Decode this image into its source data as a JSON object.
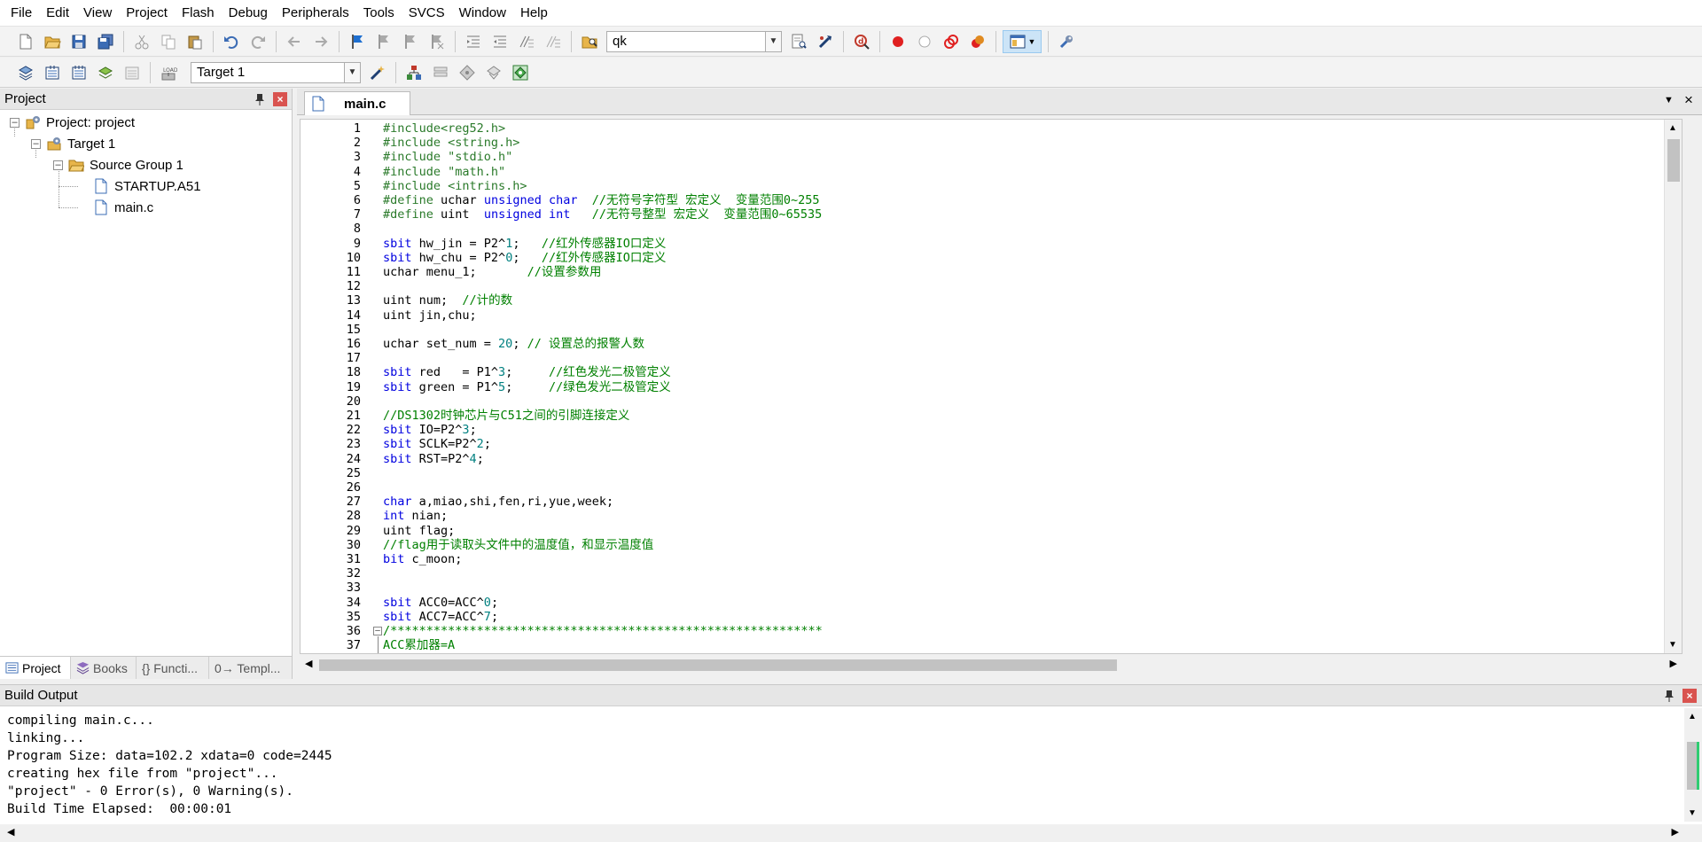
{
  "menu": [
    "File",
    "Edit",
    "View",
    "Project",
    "Flash",
    "Debug",
    "Peripherals",
    "Tools",
    "SVCS",
    "Window",
    "Help"
  ],
  "toolbar": {
    "find_value": "qk",
    "target_value": "Target 1"
  },
  "project_panel": {
    "title": "Project",
    "tree": {
      "project": "Project: project",
      "target": "Target 1",
      "group": "Source Group 1",
      "files": [
        "STARTUP.A51",
        "main.c"
      ]
    },
    "tabs": [
      "Project",
      "Books",
      "{} Functi...",
      "0→ Templ..."
    ]
  },
  "editor": {
    "tab": "main.c",
    "lines": [
      [
        [
          "p",
          "#include<reg52.h>"
        ]
      ],
      [
        [
          "p",
          "#include <string.h>"
        ]
      ],
      [
        [
          "p",
          "#include \"stdio.h\""
        ]
      ],
      [
        [
          "p",
          "#include \"math.h\""
        ]
      ],
      [
        [
          "p",
          "#include <intrins.h>"
        ]
      ],
      [
        [
          "p",
          "#define "
        ],
        [
          "t",
          "uchar "
        ],
        [
          "k",
          "unsigned char"
        ],
        [
          "t",
          "  "
        ],
        [
          "c",
          "//无符号字符型 宏定义  变量范围0~255"
        ]
      ],
      [
        [
          "p",
          "#define "
        ],
        [
          "t",
          "uint  "
        ],
        [
          "k",
          "unsigned int"
        ],
        [
          "t",
          "   "
        ],
        [
          "c",
          "//无符号整型 宏定义  变量范围0~65535"
        ]
      ],
      [],
      [
        [
          "k",
          "sbit "
        ],
        [
          "t",
          "hw_jin = P2^"
        ],
        [
          "n",
          "1"
        ],
        [
          "t",
          ";   "
        ],
        [
          "c",
          "//红外传感器IO口定义"
        ]
      ],
      [
        [
          "k",
          "sbit "
        ],
        [
          "t",
          "hw_chu = P2^"
        ],
        [
          "n",
          "0"
        ],
        [
          "t",
          ";   "
        ],
        [
          "c",
          "//红外传感器IO口定义"
        ]
      ],
      [
        [
          "t",
          "uchar menu_1;       "
        ],
        [
          "c",
          "//设置参数用"
        ]
      ],
      [],
      [
        [
          "t",
          "uint num;  "
        ],
        [
          "c",
          "//计的数"
        ]
      ],
      [
        [
          "t",
          "uint jin,chu;"
        ]
      ],
      [],
      [
        [
          "t",
          "uchar set_num = "
        ],
        [
          "n",
          "20"
        ],
        [
          "t",
          "; "
        ],
        [
          "c",
          "// 设置总的报警人数"
        ]
      ],
      [],
      [
        [
          "k",
          "sbit "
        ],
        [
          "t",
          "red   = P1^"
        ],
        [
          "n",
          "3"
        ],
        [
          "t",
          ";     "
        ],
        [
          "c",
          "//红色发光二极管定义"
        ]
      ],
      [
        [
          "k",
          "sbit "
        ],
        [
          "t",
          "green = P1^"
        ],
        [
          "n",
          "5"
        ],
        [
          "t",
          ";     "
        ],
        [
          "c",
          "//绿色发光二极管定义"
        ]
      ],
      [],
      [
        [
          "c",
          "//DS1302时钟芯片与C51之间的引脚连接定义"
        ]
      ],
      [
        [
          "k",
          "sbit "
        ],
        [
          "t",
          "IO=P2^"
        ],
        [
          "n",
          "3"
        ],
        [
          "t",
          ";"
        ]
      ],
      [
        [
          "k",
          "sbit "
        ],
        [
          "t",
          "SCLK=P2^"
        ],
        [
          "n",
          "2"
        ],
        [
          "t",
          ";"
        ]
      ],
      [
        [
          "k",
          "sbit "
        ],
        [
          "t",
          "RST=P2^"
        ],
        [
          "n",
          "4"
        ],
        [
          "t",
          ";"
        ]
      ],
      [],
      [],
      [
        [
          "k",
          "char "
        ],
        [
          "t",
          "a,miao,shi,fen,ri,yue,week;"
        ]
      ],
      [
        [
          "k",
          "int "
        ],
        [
          "t",
          "nian;"
        ]
      ],
      [
        [
          "t",
          "uint flag;"
        ]
      ],
      [
        [
          "c",
          "//flag用于读取头文件中的温度值，和显示温度值"
        ]
      ],
      [
        [
          "k",
          "bit "
        ],
        [
          "t",
          "c_moon;"
        ]
      ],
      [],
      [],
      [
        [
          "k",
          "sbit "
        ],
        [
          "t",
          "ACC0=ACC^"
        ],
        [
          "n",
          "0"
        ],
        [
          "t",
          ";"
        ]
      ],
      [
        [
          "k",
          "sbit "
        ],
        [
          "t",
          "ACC7=ACC^"
        ],
        [
          "n",
          "7"
        ],
        [
          "t",
          ";"
        ]
      ],
      [
        [
          "c",
          "/************************************************************"
        ]
      ],
      [
        [
          "c",
          "ACC累加器=A"
        ]
      ]
    ]
  },
  "build_output": {
    "title": "Build Output",
    "lines": [
      "compiling main.c...",
      "linking...",
      "Program Size: data=102.2 xdata=0 code=2445",
      "creating hex file from \"project\"...",
      "\"project\" - 0 Error(s), 0 Warning(s).",
      "Build Time Elapsed:  00:00:01"
    ]
  },
  "colors": {
    "preprocessor": "#2a7a2a",
    "keyword": "#0000e0",
    "comment": "#008000",
    "number": "#008080",
    "text": "#000000"
  }
}
